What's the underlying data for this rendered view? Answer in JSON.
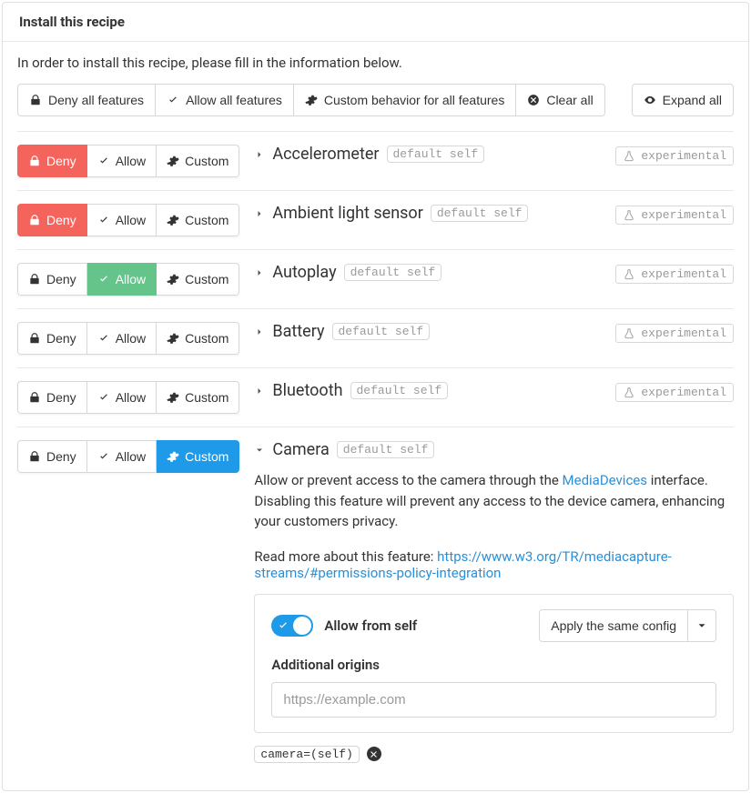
{
  "header": {
    "title": "Install this recipe"
  },
  "intro": "In order to install this recipe, please fill in the information below.",
  "toolbar": {
    "deny_all": "Deny all features",
    "allow_all": "Allow all features",
    "custom_all": "Custom behavior for all features",
    "clear_all": "Clear all",
    "expand_all": "Expand all"
  },
  "seg": {
    "deny": "Deny",
    "allow": "Allow",
    "custom": "Custom"
  },
  "badges": {
    "experimental": "experimental"
  },
  "features": [
    {
      "name": "Accelerometer",
      "default": "default self",
      "selected": "deny",
      "expanded": false,
      "experimental": true
    },
    {
      "name": "Ambient light sensor",
      "default": "default self",
      "selected": "deny",
      "expanded": false,
      "experimental": true
    },
    {
      "name": "Autoplay",
      "default": "default self",
      "selected": "allow",
      "expanded": false,
      "experimental": true
    },
    {
      "name": "Battery",
      "default": "default self",
      "selected": "",
      "expanded": false,
      "experimental": true
    },
    {
      "name": "Bluetooth",
      "default": "default self",
      "selected": "",
      "expanded": false,
      "experimental": true
    },
    {
      "name": "Camera",
      "default": "default self",
      "selected": "custom",
      "expanded": true,
      "experimental": false
    }
  ],
  "camera": {
    "desc_before": "Allow or prevent access to the camera through the ",
    "desc_link": "MediaDevices",
    "desc_after": " interface. Disabling this feature will prevent any access to the device camera, enhancing your customers privacy.",
    "read_more_label": "Read more about this feature: ",
    "read_more_url": "https://www.w3.org/TR/mediacapture-streams/#permissions-policy-integration",
    "allow_from_self": "Allow from self",
    "apply_same": "Apply the same config",
    "additional_origins": "Additional origins",
    "origins_placeholder": "https://example.com",
    "summary_code": "camera=(self)"
  }
}
